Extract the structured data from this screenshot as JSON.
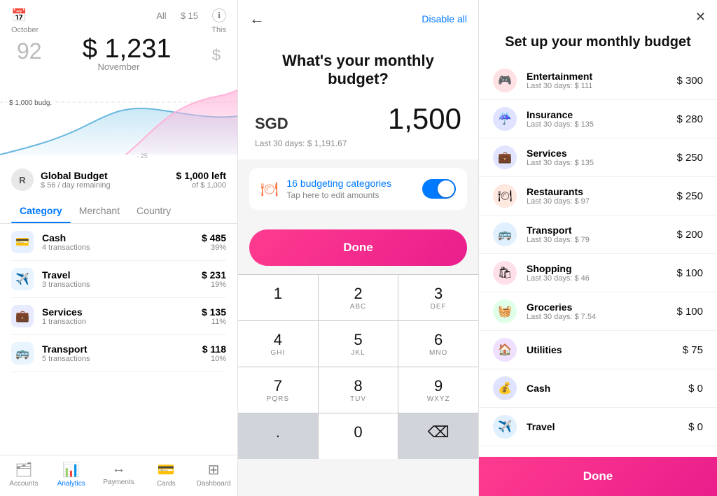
{
  "panel1": {
    "header": {
      "all_label": "All",
      "amount_label": "$ 15",
      "info_icon": "ℹ"
    },
    "main_amount": "$ 1,231",
    "month": "November",
    "budget_label": "$ 1,000 budg.",
    "this_label": "This",
    "global_budget": {
      "avatar": "R",
      "title": "Global Budget",
      "subtitle": "$ 56 / day remaining",
      "amount": "$ 1,000 left",
      "of": "of $ 1,000"
    },
    "tabs": [
      "Category",
      "Merchant",
      "Country"
    ],
    "active_tab": 0,
    "categories": [
      {
        "name": "Cash",
        "sub": "4 transactions",
        "amount": "$ 485",
        "pct": "39%",
        "icon": "💳",
        "type": "cash"
      },
      {
        "name": "Travel",
        "sub": "3 transactions",
        "amount": "$ 231",
        "pct": "19%",
        "icon": "✈️",
        "type": "travel"
      },
      {
        "name": "Services",
        "sub": "1 transaction",
        "amount": "$ 135",
        "pct": "11%",
        "icon": "💼",
        "type": "services"
      },
      {
        "name": "Transport",
        "sub": "5 transactions",
        "amount": "$ 118",
        "pct": "10%",
        "icon": "🚌",
        "type": "transport"
      }
    ],
    "nav": [
      {
        "label": "Accounts",
        "icon": "🗂",
        "active": false
      },
      {
        "label": "Analytics",
        "icon": "📊",
        "active": true
      },
      {
        "label": "Payments",
        "icon": "↔",
        "active": false
      },
      {
        "label": "Cards",
        "icon": "🃏",
        "active": false
      },
      {
        "label": "Dashboard",
        "icon": "⊞",
        "active": false
      }
    ]
  },
  "panel2": {
    "back_icon": "←",
    "disable_all": "Disable all",
    "title": "What's your monthly budget?",
    "currency": "SGD",
    "amount": "1,500",
    "last30": "Last 30 days: $ 1,191.67",
    "categories_link": "16 budgeting categories",
    "categories_sub": "Tap here to edit amounts",
    "done_label": "Done",
    "numpad": [
      {
        "digit": "1",
        "letters": ""
      },
      {
        "digit": "2",
        "letters": "ABC"
      },
      {
        "digit": "3",
        "letters": "DEF"
      },
      {
        "digit": "4",
        "letters": "GHI"
      },
      {
        "digit": "5",
        "letters": "JKL"
      },
      {
        "digit": "6",
        "letters": "MNO"
      },
      {
        "digit": "7",
        "letters": "PQRS"
      },
      {
        "digit": "8",
        "letters": "TUV"
      },
      {
        "digit": "9",
        "letters": "WXYZ"
      },
      {
        "digit": ".",
        "letters": ""
      },
      {
        "digit": "0",
        "letters": ""
      },
      {
        "digit": "⌫",
        "letters": ""
      }
    ]
  },
  "panel3": {
    "close_icon": "✕",
    "title": "Set up your monthly budget",
    "done_label": "Done",
    "categories": [
      {
        "name": "Entertainment",
        "sub": "Last 30 days: $ 111",
        "amount": "$ 300",
        "icon": "🎮",
        "color": "#ff4757"
      },
      {
        "name": "Insurance",
        "sub": "Last 30 days: $ 135",
        "amount": "$ 280",
        "icon": "☔",
        "color": "#5352ed"
      },
      {
        "name": "Services",
        "sub": "Last 30 days: $ 135",
        "amount": "$ 250",
        "icon": "💼",
        "color": "#3742fa"
      },
      {
        "name": "Restaurants",
        "sub": "Last 30 days: $ 97",
        "amount": "$ 250",
        "icon": "🍽",
        "color": "#ff6348"
      },
      {
        "name": "Transport",
        "sub": "Last 30 days: $ 79",
        "amount": "$ 200",
        "icon": "🚌",
        "color": "#1e90ff"
      },
      {
        "name": "Shopping",
        "sub": "Last 30 days: $ 46",
        "amount": "$ 100",
        "icon": "🛍",
        "color": "#ff4757"
      },
      {
        "name": "Groceries",
        "sub": "Last 30 days: $ 7.54",
        "amount": "$ 100",
        "icon": "🧺",
        "color": "#2ed573"
      },
      {
        "name": "Utilities",
        "sub": "",
        "amount": "$ 75",
        "icon": "🏠",
        "color": "#a55eea"
      },
      {
        "name": "Cash",
        "sub": "",
        "amount": "$ 0",
        "icon": "💰",
        "color": "#5352ed"
      },
      {
        "name": "Travel",
        "sub": "",
        "amount": "$ 0",
        "icon": "✈️",
        "color": "#1e90ff"
      }
    ]
  }
}
